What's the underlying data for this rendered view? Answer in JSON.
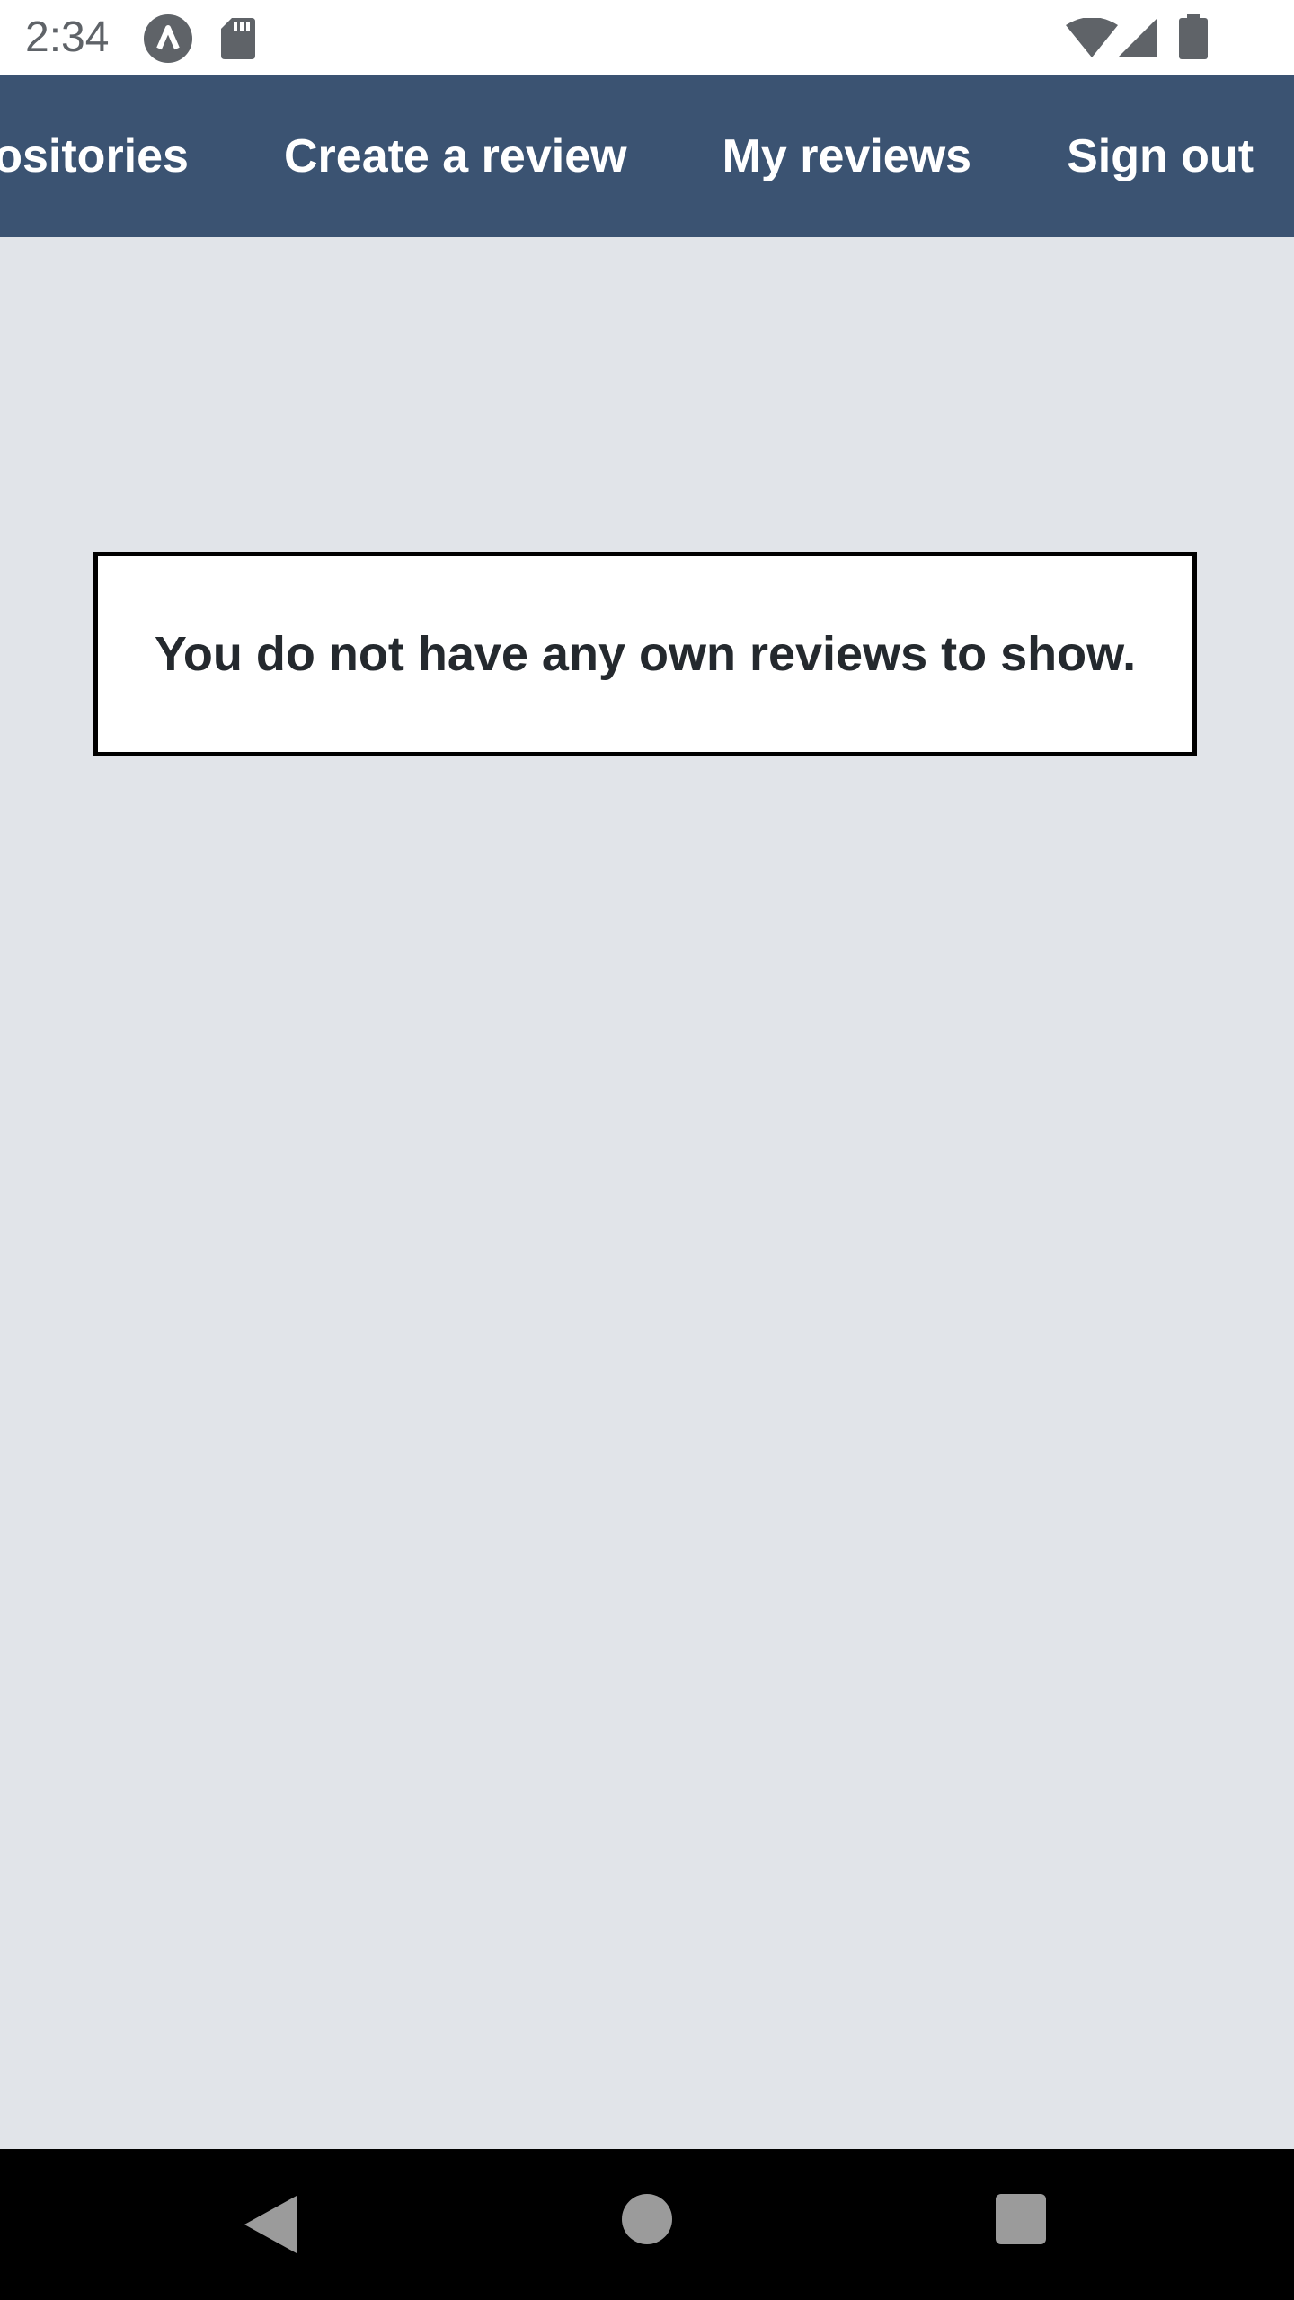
{
  "status_bar": {
    "time": "2:34",
    "icons": [
      "app-notification-icon",
      "sd-card-icon",
      "wifi-icon",
      "cell-signal-icon",
      "battery-icon"
    ]
  },
  "app_bar": {
    "background_color": "#3b5372",
    "tabs": [
      {
        "label": "Repositories"
      },
      {
        "label": "Create a review"
      },
      {
        "label": "My reviews"
      },
      {
        "label": "Sign out"
      }
    ]
  },
  "main": {
    "background_color": "#e1e4e9",
    "empty_message": "You do not have any own reviews to show."
  },
  "nav_bar": {
    "buttons": [
      "back",
      "home",
      "recents"
    ]
  }
}
